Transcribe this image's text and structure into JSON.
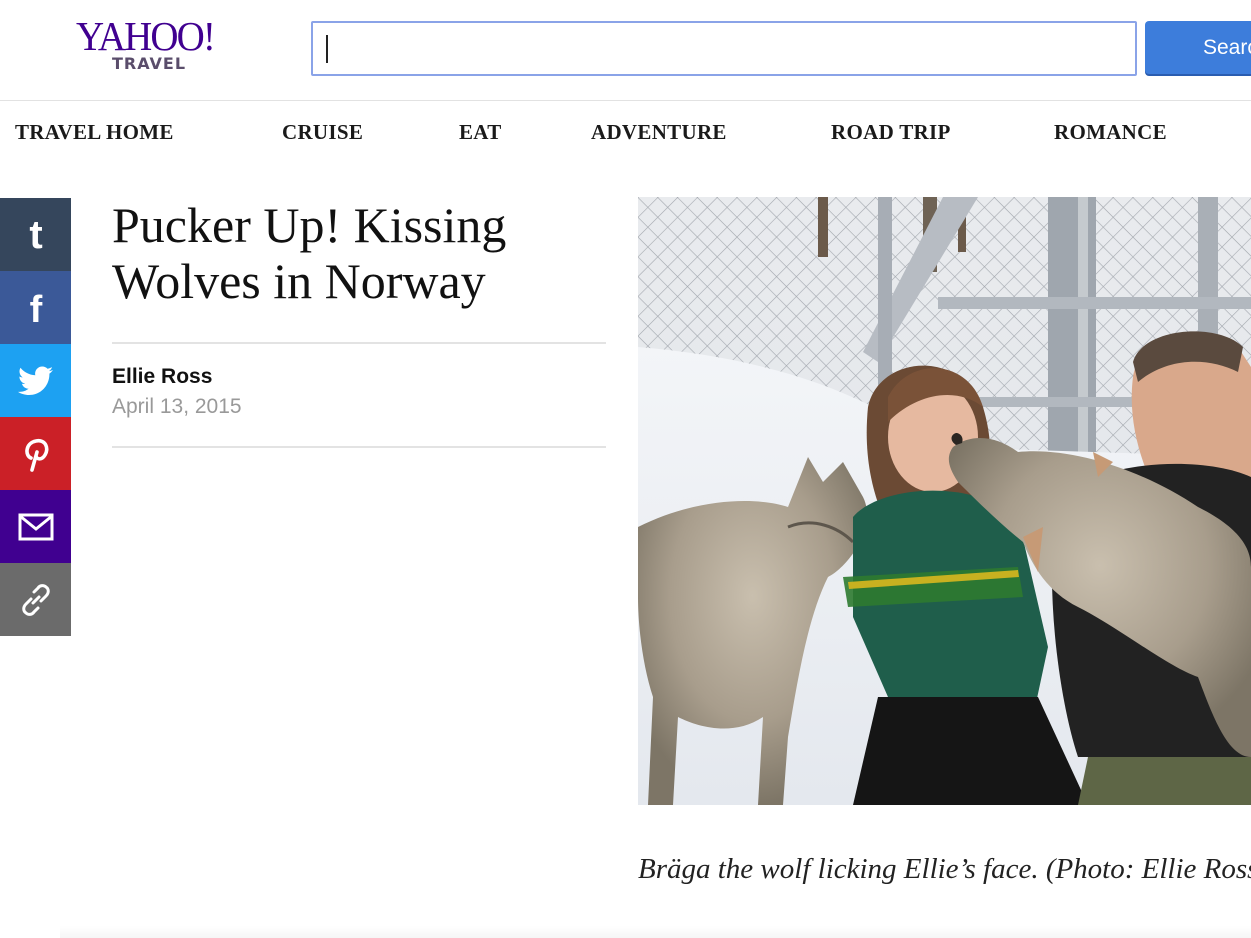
{
  "header": {
    "logo_brand": "YAHOO!",
    "logo_sub": "TRAVEL",
    "search_placeholder": "",
    "search_value": "",
    "search_button_label": "Search"
  },
  "nav": {
    "items": [
      {
        "label": "TRAVEL HOME"
      },
      {
        "label": "CRUISE"
      },
      {
        "label": "EAT"
      },
      {
        "label": "ADVENTURE"
      },
      {
        "label": "ROAD TRIP"
      },
      {
        "label": "ROMANCE"
      }
    ]
  },
  "share": {
    "buttons": [
      {
        "icon": "tumblr-icon",
        "color": "#35465c"
      },
      {
        "icon": "facebook-icon",
        "color": "#3b5998"
      },
      {
        "icon": "twitter-icon",
        "color": "#1da1f2"
      },
      {
        "icon": "pinterest-icon",
        "color": "#cb2027"
      },
      {
        "icon": "mail-icon",
        "color": "#400090"
      },
      {
        "icon": "link-icon",
        "color": "#6b6b6b"
      }
    ]
  },
  "article": {
    "title": "Pucker Up! Kissing Wolves in Norway",
    "author": "Ellie Ross",
    "date": "April 13, 2015",
    "caption": "Bräga the wolf licking Ellie’s face. (Photo: Ellie Ross)"
  },
  "colors": {
    "brand_purple": "#400090",
    "search_blue": "#3d7ddb"
  }
}
